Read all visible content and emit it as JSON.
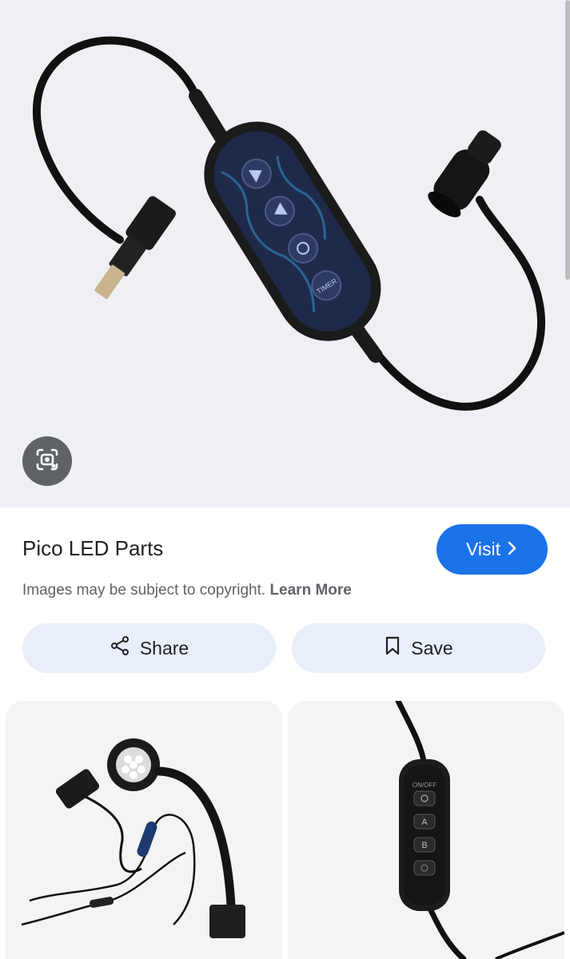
{
  "result": {
    "source_title": "Pico LED Parts",
    "visit_label": "Visit",
    "copyright_text": "Images may be subject to copyright.",
    "learn_more_label": "Learn More",
    "share_label": "Share",
    "save_label": "Save"
  },
  "icons": {
    "lens": "google-lens-icon",
    "visit": "chevron-right-icon",
    "share": "share-icon",
    "save": "bookmark-icon"
  },
  "controller_buttons": {
    "on_off": "ON/OFF",
    "a": "A",
    "b": "B",
    "timer": "TIMER"
  },
  "colors": {
    "accent": "#1a73e8",
    "action_bg": "#e8effb",
    "hero_bg": "#eef0f5"
  }
}
